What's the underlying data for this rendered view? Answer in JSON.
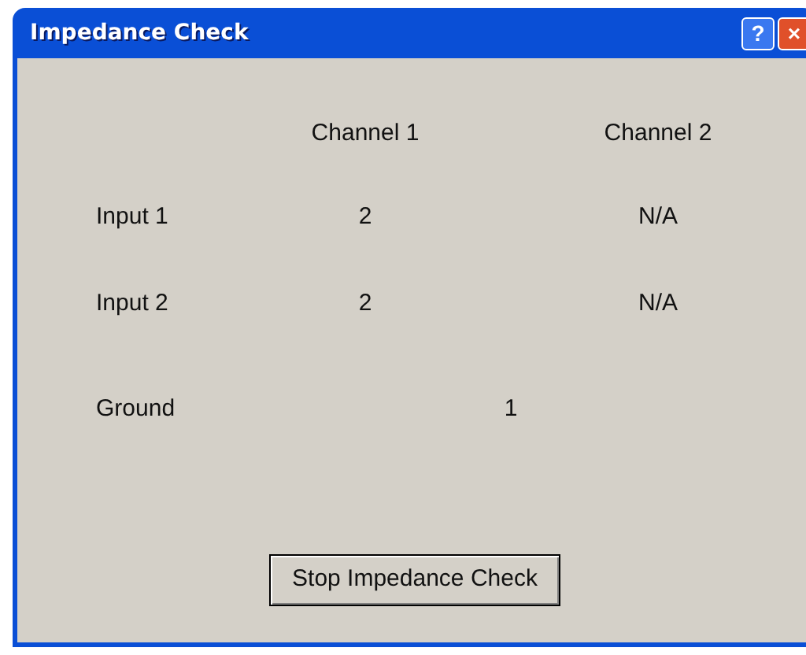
{
  "window": {
    "title": "Impedance Check",
    "buttons": [
      {
        "kind": "help",
        "label": "?"
      },
      {
        "kind": "close",
        "label": "×"
      }
    ]
  },
  "table": {
    "columns": [
      "Channel 1",
      "Channel 2"
    ],
    "rows": [
      {
        "label": "Input 1",
        "kind": "per_channel",
        "values": [
          "2",
          "N/A"
        ]
      },
      {
        "label": "Input 2",
        "kind": "per_channel",
        "values": [
          "2",
          "N/A"
        ]
      },
      {
        "label": "Ground",
        "kind": "shared",
        "values": [
          "1"
        ]
      }
    ]
  },
  "buttons": [
    "Stop Impedance Check"
  ]
}
